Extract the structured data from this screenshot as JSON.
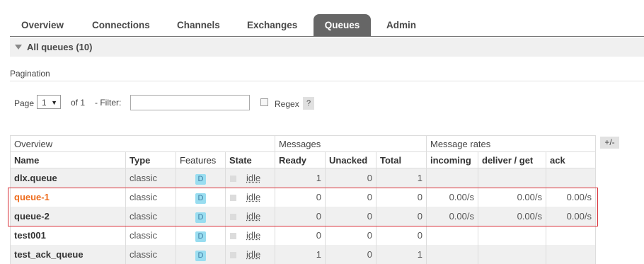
{
  "nav": {
    "tabs": [
      {
        "label": "Overview"
      },
      {
        "label": "Connections"
      },
      {
        "label": "Channels"
      },
      {
        "label": "Exchanges"
      },
      {
        "label": "Queues",
        "active": true
      },
      {
        "label": "Admin"
      }
    ]
  },
  "section": {
    "title": "All queues (10)"
  },
  "pagination": {
    "heading": "Pagination",
    "page_label": "Page",
    "page_value": "1",
    "of_label": "of 1",
    "filter_label": "- Filter:",
    "filter_value": "",
    "regex_label": "Regex",
    "regex_checked": false,
    "help_label": "?"
  },
  "table": {
    "toggle_label": "+/-",
    "groups": {
      "overview": "Overview",
      "messages": "Messages",
      "message_rates": "Message rates"
    },
    "columns": [
      "Name",
      "Type",
      "Features",
      "State",
      "Ready",
      "Unacked",
      "Total",
      "incoming",
      "deliver / get",
      "ack"
    ],
    "rows": [
      {
        "name": "dlx.queue",
        "type": "classic",
        "feature": "D",
        "state": "idle",
        "ready": "1",
        "unacked": "0",
        "total": "1",
        "incoming": "",
        "deliver_get": "",
        "ack": ""
      },
      {
        "name": "queue-1",
        "type": "classic",
        "feature": "D",
        "state": "idle",
        "ready": "0",
        "unacked": "0",
        "total": "0",
        "incoming": "0.00/s",
        "deliver_get": "0.00/s",
        "ack": "0.00/s",
        "highlighted": true
      },
      {
        "name": "queue-2",
        "type": "classic",
        "feature": "D",
        "state": "idle",
        "ready": "0",
        "unacked": "0",
        "total": "0",
        "incoming": "0.00/s",
        "deliver_get": "0.00/s",
        "ack": "0.00/s"
      },
      {
        "name": "test001",
        "type": "classic",
        "feature": "D",
        "state": "idle",
        "ready": "0",
        "unacked": "0",
        "total": "0",
        "incoming": "",
        "deliver_get": "",
        "ack": ""
      },
      {
        "name": "test_ack_queue",
        "type": "classic",
        "feature": "D",
        "state": "idle",
        "ready": "1",
        "unacked": "0",
        "total": "1",
        "incoming": "",
        "deliver_get": "",
        "ack": ""
      }
    ]
  },
  "colors": {
    "accent": "#ee6c1d",
    "active_tab": "#666666",
    "highlight_border": "#d8323a",
    "feature_badge": "#99ddf0"
  }
}
